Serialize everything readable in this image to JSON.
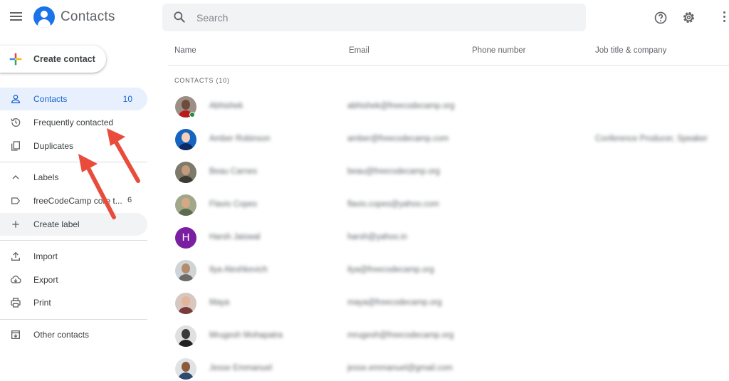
{
  "header": {
    "app_title": "Contacts",
    "menu_icon": "hamburger-menu-icon",
    "logo_icon": "contacts-logo-icon",
    "search": {
      "placeholder": "Search",
      "value": ""
    },
    "help_icon": "help-icon",
    "settings_icon": "gear-icon",
    "more_icon": "more-vert-icon"
  },
  "sidebar": {
    "create_contact_label": "Create contact",
    "nav": [
      {
        "label": "Contacts",
        "count": "10",
        "icon": "person-icon",
        "active": true
      },
      {
        "label": "Frequently contacted",
        "icon": "history-icon"
      },
      {
        "label": "Duplicates",
        "icon": "copy-icon"
      }
    ],
    "labels_header": "Labels",
    "labels": [
      {
        "label": "freeCodeCamp core t...",
        "count": "6",
        "icon": "label-icon"
      }
    ],
    "create_label": "Create label",
    "tools": [
      {
        "label": "Import",
        "icon": "upload-icon"
      },
      {
        "label": "Export",
        "icon": "cloud-download-icon"
      },
      {
        "label": "Print",
        "icon": "printer-icon"
      }
    ],
    "other_contacts": "Other contacts"
  },
  "table": {
    "columns": [
      "Name",
      "Email",
      "Phone number",
      "Job title & company"
    ],
    "section_label": "CONTACTS (10)",
    "rows": [
      {
        "name": "Abhishek",
        "email": "abhishek@freecodecamp.org",
        "job": ""
      },
      {
        "name": "Amber Robinson",
        "email": "amber@freecodecamp.com",
        "job": "Conference Producer, Speaker"
      },
      {
        "name": "Beau Carnes",
        "email": "beau@freecodecamp.org",
        "job": ""
      },
      {
        "name": "Flavio Copes",
        "email": "flavio.copes@yahoo.com",
        "job": ""
      },
      {
        "name": "Harsh Jaiswal",
        "email": "harsh@yahoo.in",
        "job": "",
        "initial": "H"
      },
      {
        "name": "Ilya Aleshkevich",
        "email": "ilya@freecodecamp.org",
        "job": ""
      },
      {
        "name": "Maya",
        "email": "maya@freecodecamp.org",
        "job": ""
      },
      {
        "name": "Mrugesh Mohapatra",
        "email": "mrugesh@freecodecamp.org",
        "job": ""
      },
      {
        "name": "Jesse Emmanuel",
        "email": "jesse.emmanuel@gmail.com",
        "job": ""
      }
    ]
  },
  "colors": {
    "accent": "#1a73e8",
    "active_bg": "#e8f0fe",
    "active_text": "#1967d2",
    "annotation_arrow": "#ea4c3c",
    "avatar_purple": "#7b1fa2"
  }
}
